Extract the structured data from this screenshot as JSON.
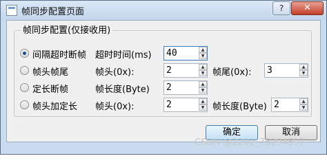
{
  "window": {
    "title": "帧同步配置页面",
    "help_label": "?",
    "close_label": "✕"
  },
  "group": {
    "title": "帧同步配置(仅接收用)"
  },
  "options": [
    {
      "label": "间隔超时断帧",
      "checked": true,
      "fields": [
        {
          "label": "超时时间(ms)",
          "value": "40"
        }
      ]
    },
    {
      "label": "帧头帧尾",
      "checked": false,
      "fields": [
        {
          "label": "帧头(0x):",
          "value": "2"
        },
        {
          "label": "帧尾(0x):",
          "value": "3"
        }
      ]
    },
    {
      "label": "定长断帧",
      "checked": false,
      "fields": [
        {
          "label": "帧长度(Byte)",
          "value": "2"
        }
      ]
    },
    {
      "label": "帧头加定长",
      "checked": false,
      "fields": [
        {
          "label": "帧头(0x):",
          "value": "2"
        },
        {
          "label": "帧长度(Byte)",
          "value": "2"
        }
      ]
    }
  ],
  "buttons": {
    "ok": "确定",
    "cancel": "取消"
  },
  "watermark": "CSDN @2201_75294597",
  "colors": {
    "window_frame": "#c9dbee",
    "close_button": "#c3402a",
    "client_bg": "#f0f0f0",
    "default_button": "#c5e2f6"
  }
}
